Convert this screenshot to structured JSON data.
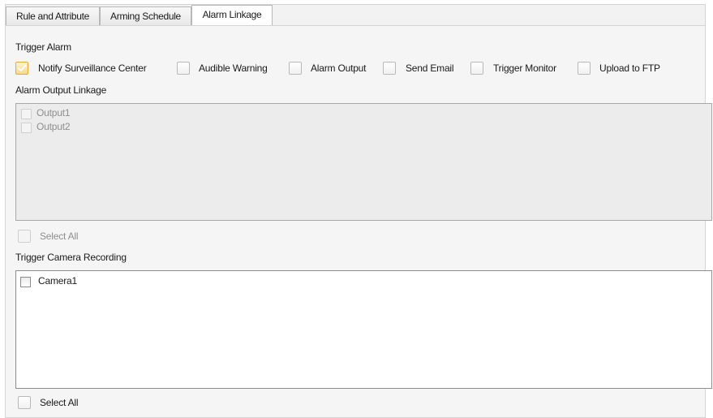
{
  "tabs": [
    {
      "label": "Rule and Attribute",
      "active": false
    },
    {
      "label": "Arming Schedule",
      "active": false
    },
    {
      "label": "Alarm Linkage",
      "active": true
    }
  ],
  "trigger_alarm": {
    "title": "Trigger Alarm",
    "options": [
      {
        "label": "Notify Surveillance Center",
        "checked": true
      },
      {
        "label": "Audible Warning",
        "checked": false
      },
      {
        "label": "Alarm Output",
        "checked": false
      },
      {
        "label": "Send Email",
        "checked": false
      },
      {
        "label": "Trigger Monitor",
        "checked": false
      },
      {
        "label": "Upload to FTP",
        "checked": false
      }
    ]
  },
  "alarm_output_linkage": {
    "title": "Alarm Output Linkage",
    "outputs": [
      {
        "label": "Output1",
        "checked": false,
        "disabled": true
      },
      {
        "label": "Output2",
        "checked": false,
        "disabled": true
      }
    ],
    "select_all_label": "Select All",
    "select_all_disabled": true
  },
  "trigger_camera_recording": {
    "title": "Trigger Camera Recording",
    "cameras": [
      {
        "label": "Camera1",
        "checked": false
      }
    ],
    "select_all_label": "Select All"
  },
  "colors": {
    "checked_accent": "#f8d98b",
    "disabled_text": "#8f8f8f",
    "panel_bg": "#f5f5f5"
  }
}
